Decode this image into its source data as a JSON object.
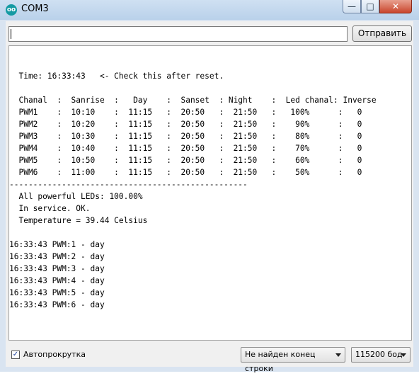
{
  "window": {
    "title": "COM3",
    "app_icon": "arduino-logo-icon",
    "app_icon_text": "oo",
    "controls": [
      "minimize-icon",
      "maximize-icon",
      "close-icon"
    ],
    "minimize_glyph": "—",
    "maximize_glyph": "□",
    "close_glyph": "✕"
  },
  "input": {
    "value": "",
    "placeholder": ""
  },
  "send_button": {
    "label": "Отправить"
  },
  "console": {
    "lines": [
      "",
      "",
      "  Time: 16:33:43   <- Check this after reset.",
      "",
      "  Chanal  :  Sanrise  :   Day    :  Sanset  : Night    :  Led chanal: Inverse",
      "  PWM1    :  10:10    :  11:15   :  20:50   :  21:50   :   100%      :   0",
      "  PWM2    :  10:20    :  11:15   :  20:50   :  21:50   :    90%      :   0",
      "  PWM3    :  10:30    :  11:15   :  20:50   :  21:50   :    80%      :   0",
      "  PWM4    :  10:40    :  11:15   :  20:50   :  21:50   :    70%      :   0",
      "  PWM5    :  10:50    :  11:15   :  20:50   :  21:50   :    60%      :   0",
      "  PWM6    :  11:00    :  11:15   :  20:50   :  21:50   :    50%      :   0",
      "--------------------------------------------------",
      "  All powerful LEDs: 100.00%",
      "  In service. OK.",
      "  Temperature = 39.44 Celsius",
      "",
      "16:33:43 PWM:1 - day",
      "16:33:43 PWM:2 - day",
      "16:33:43 PWM:3 - day",
      "16:33:43 PWM:4 - day",
      "16:33:43 PWM:5 - day",
      "16:33:43 PWM:6 - day"
    ]
  },
  "status_bar": {
    "autoscroll_label": "Автопрокрутка",
    "autoscroll_checked": true,
    "checkmark": "✓",
    "line_ending": "Не найден конец строки",
    "baud_rate": "115200 бод"
  }
}
